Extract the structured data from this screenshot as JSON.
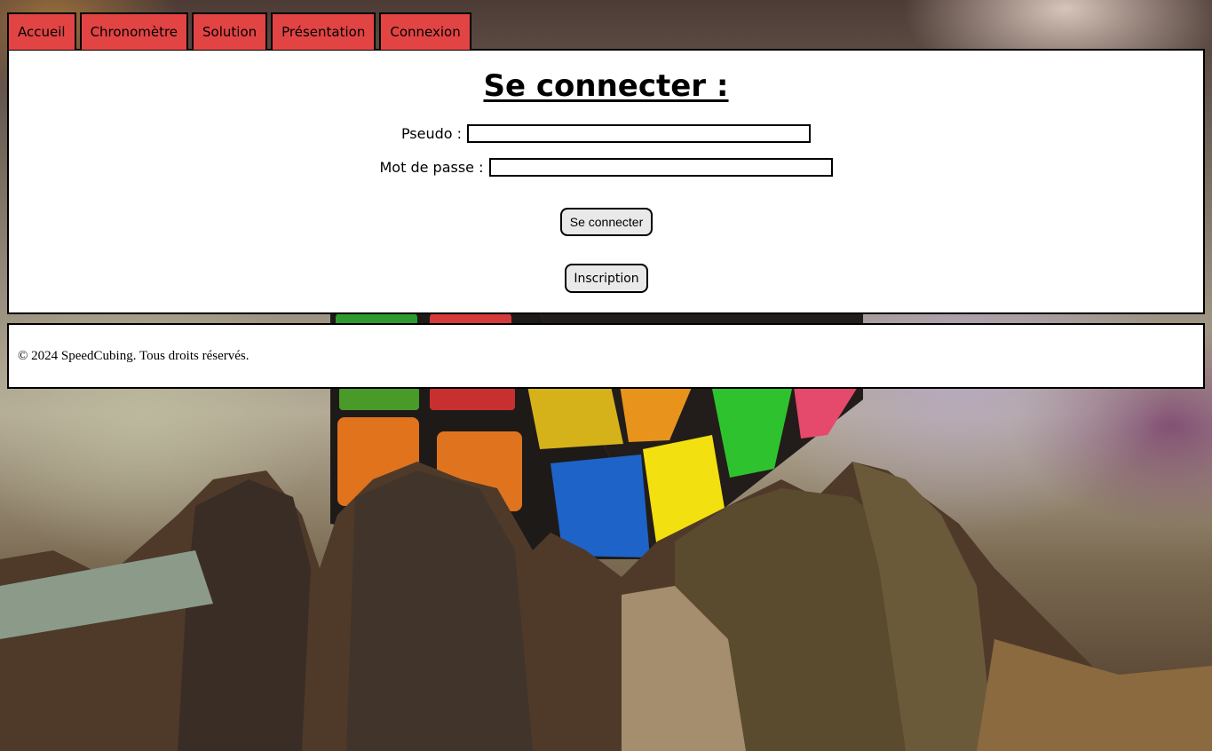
{
  "nav": {
    "tabs": [
      {
        "label": "Accueil"
      },
      {
        "label": "Chronomètre"
      },
      {
        "label": "Solution"
      },
      {
        "label": "Présentation"
      },
      {
        "label": "Connexion"
      }
    ],
    "tab_color": "#e24444"
  },
  "login": {
    "title": "Se connecter :",
    "username_label": "Pseudo :",
    "username_value": "",
    "password_label": "Mot de passe :",
    "password_value": "",
    "submit_label": "Se connecter",
    "register_label": "Inscription"
  },
  "footer": {
    "text": "© 2024 SpeedCubing. Tous droits réservés."
  },
  "background": {
    "image": "rubiks-cube-on-wooden-stump"
  }
}
